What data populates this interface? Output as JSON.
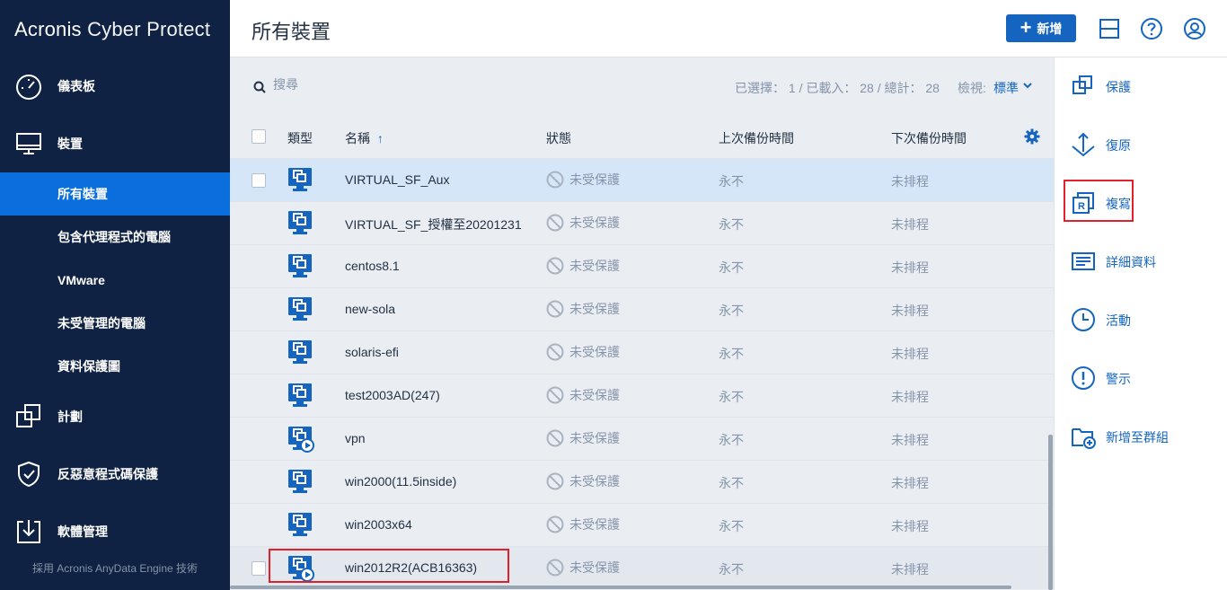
{
  "brand": {
    "name_bold": "Acronis",
    "name_light": "Cyber Protect"
  },
  "sidebar": {
    "main_items": [
      {
        "label": "儀表板",
        "icon": "dashboard-icon"
      },
      {
        "label": "裝置",
        "icon": "monitor-icon"
      },
      {
        "label": "計劃",
        "icon": "plans-icon"
      },
      {
        "label": "反惡意程式碼保護",
        "icon": "shield-check-icon"
      },
      {
        "label": "軟體管理",
        "icon": "download-box-icon"
      }
    ],
    "sub_items": [
      {
        "label": "所有裝置",
        "active": true
      },
      {
        "label": "包含代理程式的電腦"
      },
      {
        "label": "VMware"
      },
      {
        "label": "未受管理的電腦"
      },
      {
        "label": "資料保護圖"
      }
    ],
    "footer": "採用 Acronis AnyData Engine 技術"
  },
  "header": {
    "title": "所有裝置",
    "add_label": "新增",
    "icons": [
      "layout-icon",
      "help-icon",
      "account-icon"
    ]
  },
  "toolbar": {
    "search_placeholder": "搜尋",
    "stats": "已選擇： 1 / 已載入： 28 / 總計： 28",
    "view_label": "檢視:",
    "view_value": "標準"
  },
  "table": {
    "columns": {
      "type": "類型",
      "name": "名稱",
      "status": "狀態",
      "last_backup": "上次備份時間",
      "next_backup": "下次備份時間"
    },
    "sort_indicator": "↑",
    "rows": [
      {
        "name": "VIRTUAL_SF_Aux",
        "status": "未受保護",
        "last": "永不",
        "next": "未排程",
        "selected": true,
        "kind": "vm"
      },
      {
        "name": "VIRTUAL_SF_授權至20201231",
        "status": "未受保護",
        "last": "永不",
        "next": "未排程",
        "kind": "vm"
      },
      {
        "name": "centos8.1",
        "status": "未受保護",
        "last": "永不",
        "next": "未排程",
        "kind": "vm"
      },
      {
        "name": "new-sola",
        "status": "未受保護",
        "last": "永不",
        "next": "未排程",
        "kind": "vm"
      },
      {
        "name": "solaris-efi",
        "status": "未受保護",
        "last": "永不",
        "next": "未排程",
        "kind": "vm"
      },
      {
        "name": "test2003AD(247)",
        "status": "未受保護",
        "last": "永不",
        "next": "未排程",
        "kind": "vm"
      },
      {
        "name": "vpn",
        "status": "未受保護",
        "last": "永不",
        "next": "未排程",
        "kind": "vm-running"
      },
      {
        "name": "win2000(11.5inside)",
        "status": "未受保護",
        "last": "永不",
        "next": "未排程",
        "kind": "vm"
      },
      {
        "name": "win2003x64",
        "status": "未受保護",
        "last": "永不",
        "next": "未排程",
        "kind": "vm"
      },
      {
        "name": "win2012R2(ACB16363)",
        "status": "未受保護",
        "last": "永不",
        "next": "未排程",
        "kind": "vm-running"
      }
    ]
  },
  "actions": [
    {
      "label": "保護",
      "icon": "protect-icon"
    },
    {
      "label": "復原",
      "icon": "recover-icon"
    },
    {
      "label": "複寫",
      "icon": "replicate-icon"
    },
    {
      "label": "詳細資料",
      "icon": "details-icon"
    },
    {
      "label": "活動",
      "icon": "clock-icon"
    },
    {
      "label": "警示",
      "icon": "alert-icon"
    },
    {
      "label": "新增至群組",
      "icon": "add-to-group-icon"
    }
  ],
  "colors": {
    "sidebar": "#0f2243",
    "accent": "#1565c0",
    "active": "#0a6fdc",
    "highlight": "#e0212b"
  }
}
